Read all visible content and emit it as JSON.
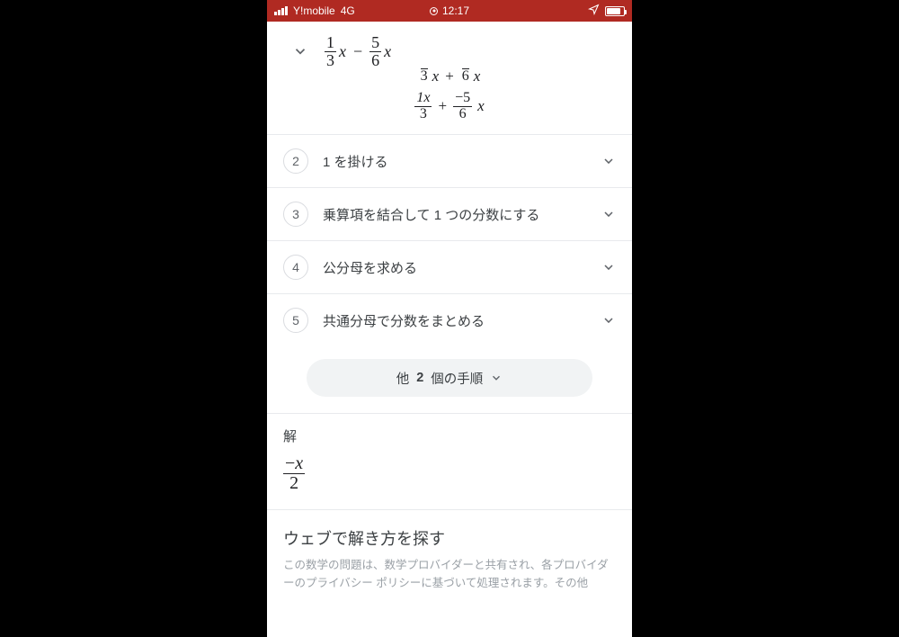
{
  "status": {
    "carrier": "Y!mobile",
    "network": "4G",
    "time": "12:17"
  },
  "header_expression": {
    "t1_num": "1",
    "t1_den": "3",
    "t1_var": "x",
    "op": "−",
    "t2_num": "5",
    "t2_den": "6",
    "t2_var": "x"
  },
  "work_lines": [
    {
      "a_den": "3",
      "a_var": "x",
      "op": "+",
      "b_den": "6",
      "b_var": "x"
    },
    {
      "a_num": "1x",
      "a_den": "3",
      "op": "+",
      "b_num": "−5",
      "b_den": "6",
      "b_var": "x"
    }
  ],
  "steps": [
    {
      "n": "2",
      "label": "1 を掛ける"
    },
    {
      "n": "3",
      "label": "乗算項を結合して 1 つの分数にする"
    },
    {
      "n": "4",
      "label": "公分母を求める"
    },
    {
      "n": "5",
      "label": "共通分母で分数をまとめる"
    }
  ],
  "more_steps": {
    "prefix": "他 ",
    "count": "2",
    "suffix": " 個の手順"
  },
  "solution": {
    "title": "解",
    "num": "−x",
    "den": "2"
  },
  "web": {
    "title": "ウェブで解き方を探す",
    "desc": "この数学の問題は、数学プロバイダーと共有され、各プロバイダーのプライバシー ポリシーに基づいて処理されます。その他"
  }
}
